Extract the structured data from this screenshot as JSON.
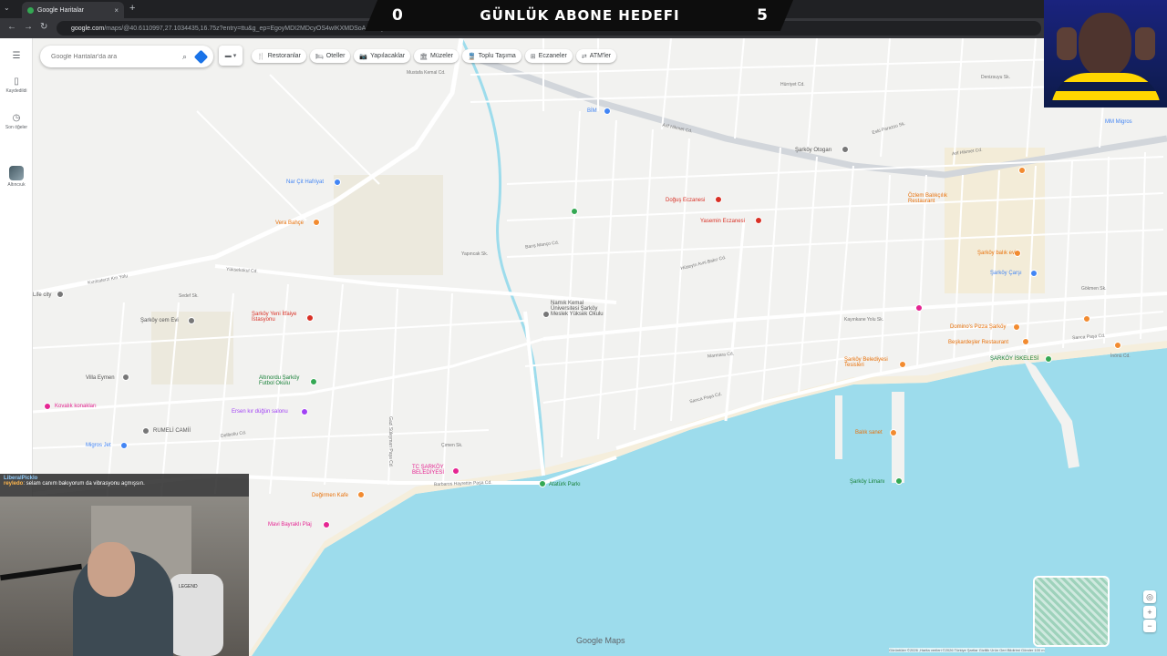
{
  "browser": {
    "tab_title": "Google Haritalar",
    "new_tab": "+",
    "close": "×",
    "url_host": "google.com",
    "url_path": "/maps/@40.6110997,27.1034435,16.75z?entry=ttu&g_ep=EgoyMDI2MDcyOS4wIKXMDSoASAFQAw%3D%3D"
  },
  "stream_overlay": {
    "left_count": "0",
    "title": "GÜNLÜK ABONE HEDEFI",
    "right_count": "5"
  },
  "sidebar": {
    "menu_icon": "☰",
    "items": [
      {
        "icon": "bookmark-icon",
        "label": "Kaydedildi"
      },
      {
        "icon": "history-icon",
        "label": "Son öğeler"
      },
      {
        "icon": "place-thumbnail",
        "label": "Altıncıuk"
      }
    ]
  },
  "search": {
    "placeholder": "Google Haritalar'da ara"
  },
  "chips": [
    {
      "icon": "🍴",
      "label": "Restoranlar"
    },
    {
      "icon": "🛏",
      "label": "Oteller"
    },
    {
      "icon": "📷",
      "label": "Yapılacaklar"
    },
    {
      "icon": "🏛",
      "label": "Müzeler"
    },
    {
      "icon": "🚆",
      "label": "Toplu Taşıma"
    },
    {
      "icon": "⊞",
      "label": "Eczaneler"
    },
    {
      "icon": "⇄",
      "label": "ATM'ler"
    }
  ],
  "places": [
    {
      "name": "Nar Çit Hafriyat",
      "color": "#4285f4"
    },
    {
      "name": "Vera Bahçe",
      "color": "#f28b30"
    },
    {
      "name": "BİM",
      "color": "#4285f4"
    },
    {
      "name": "Doğuş Eczanesi",
      "color": "#d93025"
    },
    {
      "name": "Yasemin Eczanesi",
      "color": "#d93025"
    },
    {
      "name": "Şarköy Otogarı",
      "color": "#777777"
    },
    {
      "name": "Özlem Balıkçılık Restaurant",
      "color": "#f28b30"
    },
    {
      "name": "Şarköy balık evi",
      "color": "#f28b30"
    },
    {
      "name": "Şarköy Çarşı",
      "color": "#4285f4"
    },
    {
      "name": "MM Migros",
      "color": "#4285f4"
    },
    {
      "name": "Namık Kemal Üniversitesi Şarköy Meslek Yüksek Okulu",
      "color": "#777777"
    },
    {
      "name": "Şarköy Yeni İtfaiye İstasyonu",
      "color": "#d93025"
    },
    {
      "name": "Şarköy cem Evi",
      "color": "#777777"
    },
    {
      "name": "Villa Eymen",
      "color": "#777777"
    },
    {
      "name": "Altınordu Şarköy Futbol Okulu",
      "color": "#34a853"
    },
    {
      "name": "Ersen kır düğün salonu",
      "color": "#a142f4"
    },
    {
      "name": "Kovalık konakları",
      "color": "#e52592"
    },
    {
      "name": "RUMELİ CAMİİ",
      "color": "#777777"
    },
    {
      "name": "Migros Jet",
      "color": "#4285f4"
    },
    {
      "name": "TC ŞARKÖY BELEDİYESİ",
      "color": "#e52592"
    },
    {
      "name": "Değirmen Kafe",
      "color": "#f28b30"
    },
    {
      "name": "Mavi Bayraklı Plaj",
      "color": "#e52592"
    },
    {
      "name": "Atatürk Parkı",
      "color": "#34a853"
    },
    {
      "name": "Domino's Pizza Şarköy",
      "color": "#f28b30"
    },
    {
      "name": "Beşkardeşler Restaurant",
      "color": "#f28b30"
    },
    {
      "name": "Şarköy Belediyesi Tesisleri",
      "color": "#f28b30"
    },
    {
      "name": "ŞARKÖY İSKELESİ",
      "color": "#34a853"
    },
    {
      "name": "Balık sanet",
      "color": "#f28b30"
    },
    {
      "name": "Şarköy Limanı",
      "color": "#34a853"
    },
    {
      "name": "Life city",
      "color": "#777777"
    }
  ],
  "streets": [
    "Arif Hikmet Cd.",
    "Kızılcaterzi Kırı Yolu",
    "Yüksekokul Cd.",
    "Barbaros Hayrettin Paşa Cd.",
    "Sarıca Paşa Cd.",
    "Marmara Cd.",
    "Mustafa Kemal Cd.",
    "Gökmen Sk.",
    "İnönü Cd.",
    "Hürriyet Cd.",
    "Barış Manço Cd.",
    "Hüseyin Avni Bakır Cd.",
    "Çımen Sk.",
    "Yapıncak Sk.",
    "Kayınkane Yolu Sk.",
    "Eski Parazsu Sk.",
    "Denizsuyu Sk.",
    "Gazi Süleyman Paşa Cd.",
    "Deliboliu Cd.",
    "Sedef Sk."
  ],
  "chat": {
    "line1_user": "LiberalPicklo",
    "line2_user": "reyledo",
    "line2_msg": ": selam canım bakıyorum da vibrasyonu açmışsın."
  },
  "webcam": {
    "chair_brand": "LEGEND"
  },
  "map_controls": {
    "locate": "◎",
    "zoom_in": "+",
    "zoom_out": "−",
    "logo": "Google Maps",
    "footer": "Görüntüler ©2026 ,Harita verileri ©2026   Türkiye   Şartlar   Gizlilik   Ürün Geri Bildirimi Gönder   100 m"
  }
}
